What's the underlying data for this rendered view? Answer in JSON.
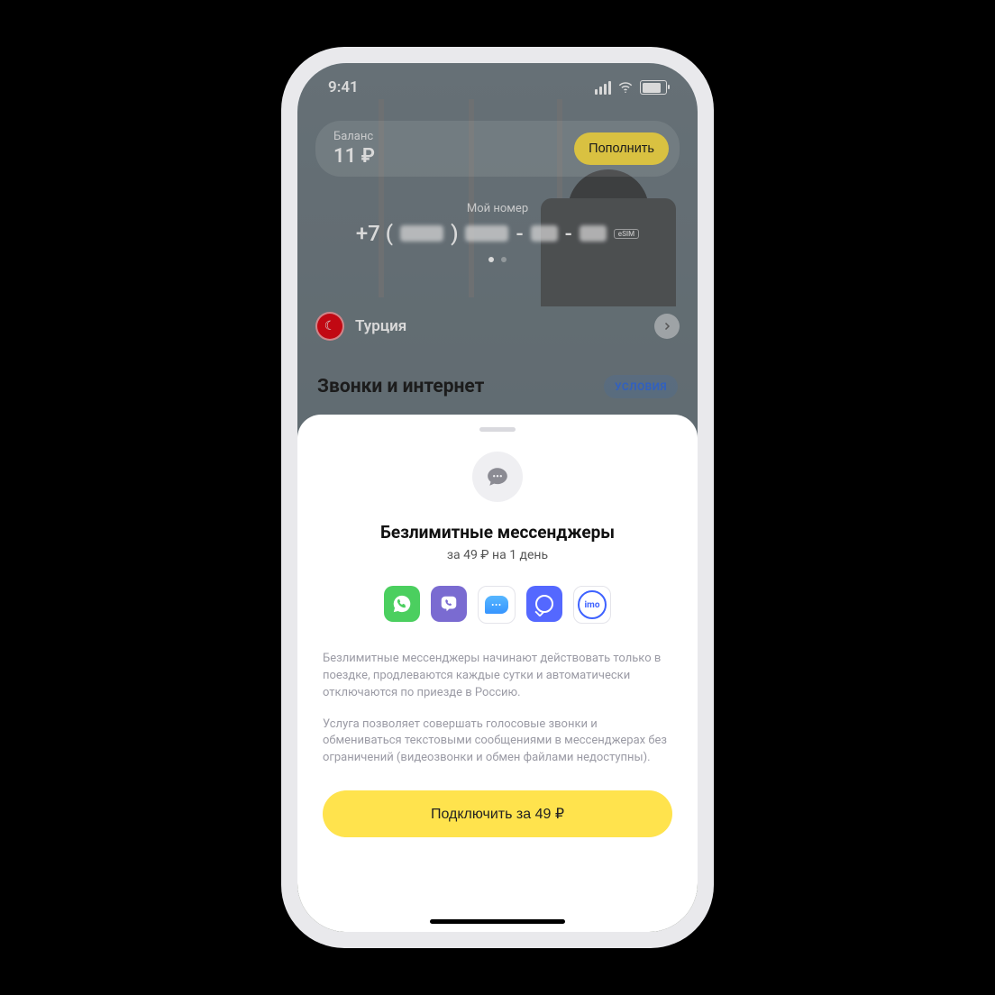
{
  "statusbar": {
    "time": "9:41"
  },
  "header": {
    "balance_label": "Баланс",
    "balance_value": "11 ₽",
    "topup": "Пополнить",
    "my_number_label": "Мой номер",
    "phone_prefix": "+7 (",
    "phone_close": ")",
    "phone_sep": "-",
    "esim": "eSIM"
  },
  "country": {
    "name": "Турция",
    "flag_glyph": "☾"
  },
  "section": {
    "title": "Звонки и интернет",
    "conditions": "УСЛОВИЯ"
  },
  "sheet": {
    "title": "Безлимитные мессенджеры",
    "price": "за 49 ₽ на 1 день",
    "apps": {
      "whatsapp_label": "WhatsApp",
      "viber_label": "Viber",
      "imessage_label": "iMessage",
      "signal_label": "Signal",
      "imo_label": "imo",
      "imo_text": "imo"
    },
    "desc1": "Безлимитные мессенджеры начинают действовать только в поездке, продлеваются каждые сутки и автоматически отключаются по приезде в Россию.",
    "desc2": "Услуга позволяет совершать голосовые звонки и обмениваться текстовыми сообщениями в мессенджерах без ограничений (видеозвонки и обмен файлами недоступны).",
    "cta": "Подключить за 49 ₽"
  }
}
